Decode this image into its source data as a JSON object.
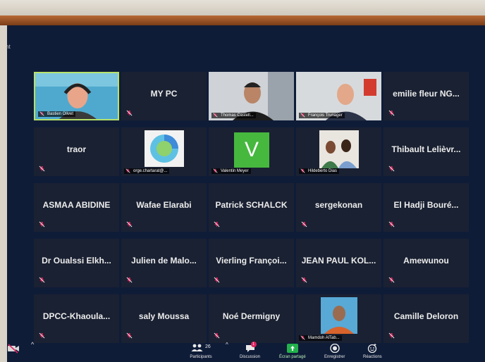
{
  "window": {
    "left_label": "nt"
  },
  "participants": [
    {
      "name": "Bastien Olivet",
      "display": "video",
      "active": true
    },
    {
      "name": "MY PC",
      "display": "name"
    },
    {
      "name": "Thomas Castell...",
      "display": "video"
    },
    {
      "name": "François Trunager",
      "display": "video"
    },
    {
      "name": "emilie fleur NG...",
      "display": "name"
    },
    {
      "name": "traor",
      "display": "name"
    },
    {
      "name": "orge.chartarat@...",
      "display": "logo"
    },
    {
      "name": "Valentin Meyer",
      "display": "avatar",
      "avatar_letter": "V"
    },
    {
      "name": "Hildeberto Dias",
      "display": "video"
    },
    {
      "name": "Thibault Lelièvr...",
      "display": "name"
    },
    {
      "name": "ASMAA ABIDINE",
      "display": "name"
    },
    {
      "name": "Wafae Elarabi",
      "display": "name"
    },
    {
      "name": "Patrick SCHALCK",
      "display": "name"
    },
    {
      "name": "sergekonan",
      "display": "name"
    },
    {
      "name": "El Hadji Bouré...",
      "display": "name"
    },
    {
      "name": "Dr Oualssi Elkh...",
      "display": "name"
    },
    {
      "name": "Julien de Malo...",
      "display": "name"
    },
    {
      "name": "Vierling Françoi...",
      "display": "name"
    },
    {
      "name": "JEAN PAUL KOL...",
      "display": "name"
    },
    {
      "name": "Amewunou",
      "display": "name"
    },
    {
      "name": "DPCC-Khaoula...",
      "display": "name"
    },
    {
      "name": "saly Moussa",
      "display": "name"
    },
    {
      "name": "Noé Dermigny",
      "display": "name"
    },
    {
      "name": "Mamdoh AlTab...",
      "display": "video"
    },
    {
      "name": "Camille Deloron",
      "display": "name"
    }
  ],
  "toolbar": {
    "participants_label": "Participants",
    "participants_count": "26",
    "chat_label": "Discussion",
    "chat_badge": "1",
    "share_label": "Écran partagé",
    "record_label": "Enregistrer",
    "reactions_label": "Réactions"
  },
  "colors": {
    "tile_bg": "#1a2132",
    "screen_bg": "#0f1c38",
    "active_border": "#b7e06a",
    "share_green": "#22b14c",
    "mic_red": "#e0245e",
    "avatar_green": "#46b83e"
  }
}
